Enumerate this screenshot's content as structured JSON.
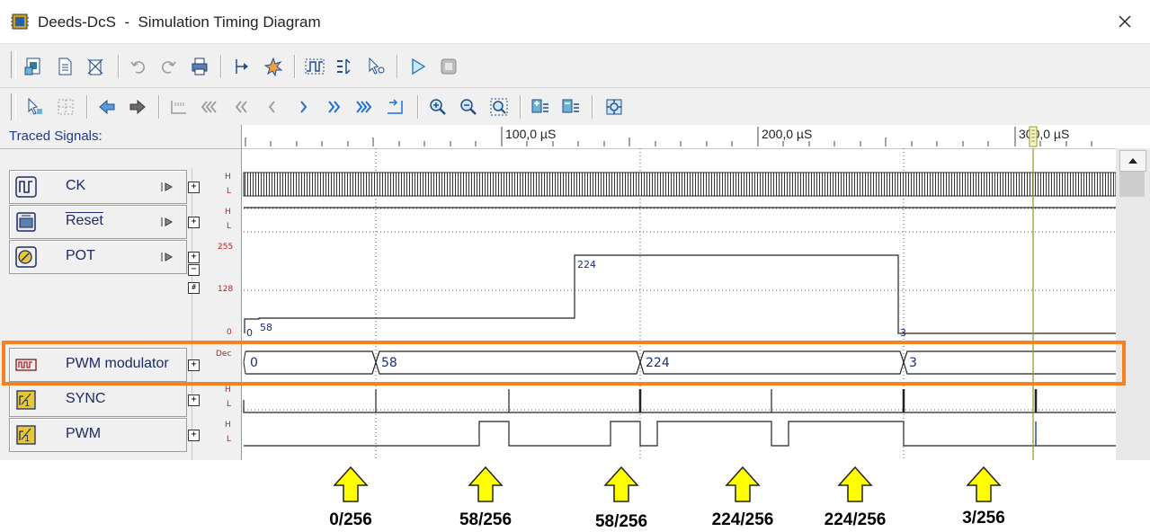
{
  "window": {
    "title": "Deeds-DcS  -  Simulation Timing Diagram"
  },
  "toolbar1": {
    "icons": [
      "timing-file-icon",
      "new-page-icon",
      "clear-page-icon",
      "undo-icon",
      "redo-icon",
      "print-icon",
      "zoom-in-marker-icon",
      "burst-icon",
      "wave-setup-icon",
      "signal-order-icon",
      "cursor-select-icon",
      "run-simulation-icon",
      "stop-simulation-icon"
    ]
  },
  "toolbar2": {
    "icons": [
      "cursor-pointer-icon",
      "grid-icon",
      "back-icon",
      "forward-icon",
      "trace-start-icon",
      "fast-rewind-3-icon",
      "rewind-2-icon",
      "step-back-icon",
      "step-forward-icon",
      "forward-2-icon",
      "fast-forward-3-icon",
      "trace-end-icon",
      "zoom-in-icon",
      "zoom-out-icon",
      "zoom-fit-icon",
      "expand-icon",
      "collapse-icon",
      "settings-icon"
    ]
  },
  "signal_panel": {
    "header": "Traced Signals:",
    "signals": [
      {
        "name": "CK",
        "icon": "clock-icon"
      },
      {
        "name": "Reset",
        "icon": "reset-icon"
      },
      {
        "name": "POT",
        "icon": "potentiometer-icon"
      },
      {
        "name": "PWM modulator",
        "icon": "pwm-modulator-icon"
      },
      {
        "name": "SYNC",
        "icon": "digital-output-icon"
      },
      {
        "name": "PWM",
        "icon": "digital-output-icon"
      }
    ],
    "level_labels": {
      "high": "H",
      "low": "L",
      "pot_max": "255",
      "pot_mid": "128",
      "pot_min": "0",
      "dec": "Dec"
    }
  },
  "ruler": {
    "labels": [
      "100,0 µS",
      "200,0 µS",
      "300,0 µS"
    ]
  },
  "waveforms": {
    "pot_values": [
      "58",
      "224",
      "3",
      "0"
    ],
    "pwm_modulator_values": [
      "0",
      "58",
      "224",
      "3"
    ]
  },
  "annotations": [
    {
      "label": "0/256"
    },
    {
      "label": "58/256"
    },
    {
      "label": "58/256"
    },
    {
      "label": "224/256"
    },
    {
      "label": "224/256"
    },
    {
      "label": "3/256"
    }
  ],
  "colors": {
    "highlight": "#f58220",
    "arrow_fill": "#ffff00",
    "grid_dotted": "#cc2222",
    "cursor_line": "#9a9a30",
    "value_text": "#1a2a80"
  }
}
